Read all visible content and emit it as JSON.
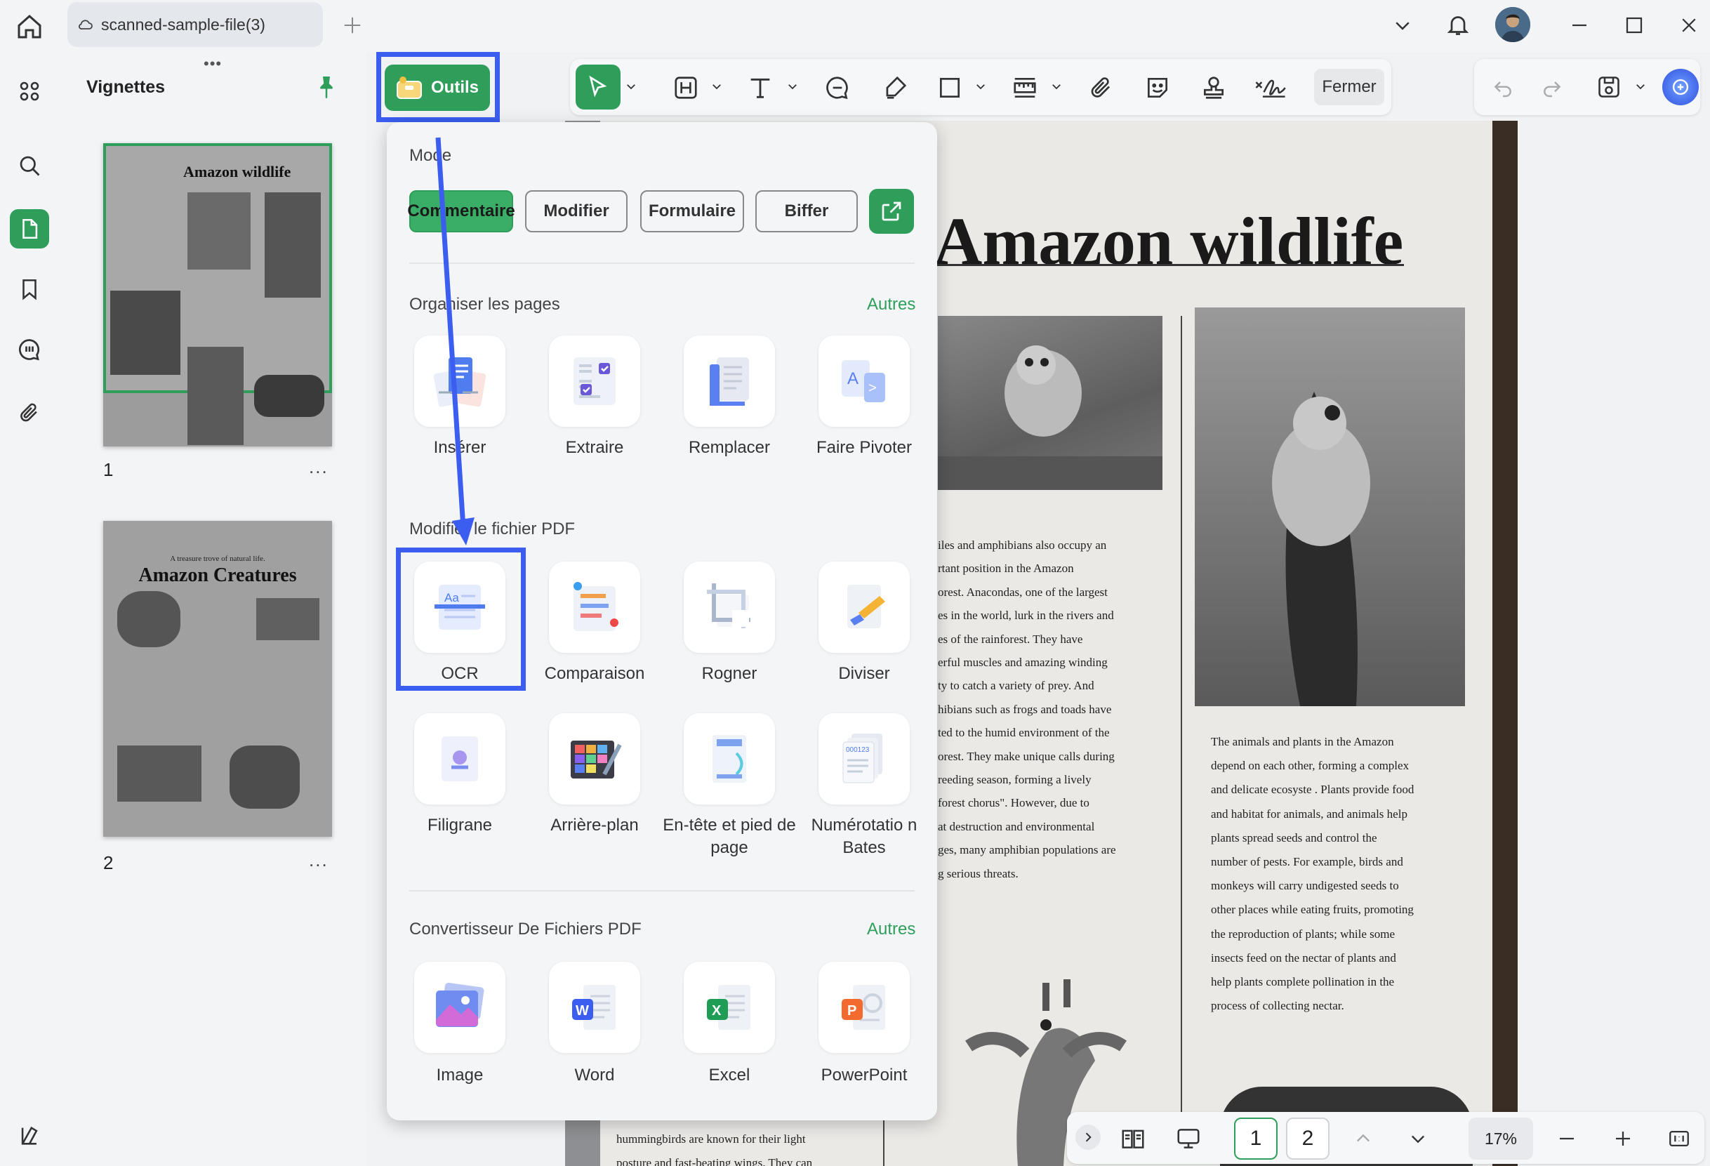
{
  "window": {
    "tab_title": "scanned-sample-file(3)"
  },
  "sidebar": {
    "title": "Vignettes",
    "pages": [
      {
        "number": "1",
        "thumb_title": "Amazon wildlife"
      },
      {
        "number": "2",
        "thumb_subtitle": "A treasure trove of natural life.",
        "thumb_title": "Amazon Creatures"
      }
    ],
    "more": "..."
  },
  "toolbar": {
    "outils_label": "Outils",
    "close_label": "Fermer"
  },
  "tools_panel": {
    "mode_title": "Mode",
    "modes": [
      "Commentaire",
      "Modifier",
      "Formulaire",
      "Biffer"
    ],
    "organize_title": "Organiser les pages",
    "organize_more": "Autres",
    "organize_items": [
      "Insérer",
      "Extraire",
      "Remplacer",
      "Faire Pivoter"
    ],
    "modify_title": "Modifier le fichier PDF",
    "modify_items": [
      "OCR",
      "Comparaison",
      "Rogner",
      "Diviser",
      "Filigrane",
      "Arrière-plan",
      "En-tête et pied de page",
      "Numérotatio n Bates"
    ],
    "convert_title": "Convertisseur De Fichiers PDF",
    "convert_more": "Autres",
    "convert_items": [
      "Image",
      "Word",
      "Excel",
      "PowerPoint"
    ]
  },
  "document": {
    "title": "Amazon wildlife",
    "left_column": [
      "iles and amphibians also occupy an",
      "rtant position in the Amazon",
      "orest. Anacondas, one of the largest",
      "es in the world, lurk in the rivers and",
      "es of the rainforest. They have",
      "erful muscles and amazing winding",
      "ty to catch a variety of prey. And",
      "hibians such as frogs and toads have",
      "ted to the humid environment of the",
      "orest. They make unique calls during",
      "reeding season, forming a lively",
      "forest chorus\". However, due to",
      "at destruction and environmental",
      "ges, many amphibian populations are",
      "g serious threats."
    ],
    "right_column": [
      "The animals and plants in the Amazon",
      "depend on each other, forming a complex",
      "and delicate ecosyste    . Plants provide food",
      "and habitat for animals, and animals help",
      "plants spread seeds and control the",
      "number of pests. For example, birds and",
      "monkeys will carry undigested seeds to",
      "other places while eating fruits, promoting",
      "the reproduction of plants; while some",
      "insects feed on the nectar of plants and",
      "help plants complete pollination in the",
      "process of collecting nectar."
    ],
    "bottom_lines": [
      "hummingbirds are known for their light",
      "posture and fast-beating wings. They can"
    ]
  },
  "bottom_bar": {
    "pages": [
      "1",
      "2"
    ],
    "zoom": "17%"
  },
  "colors": {
    "accent_green": "#2f9e5b",
    "highlight_blue": "#3b5df0"
  }
}
